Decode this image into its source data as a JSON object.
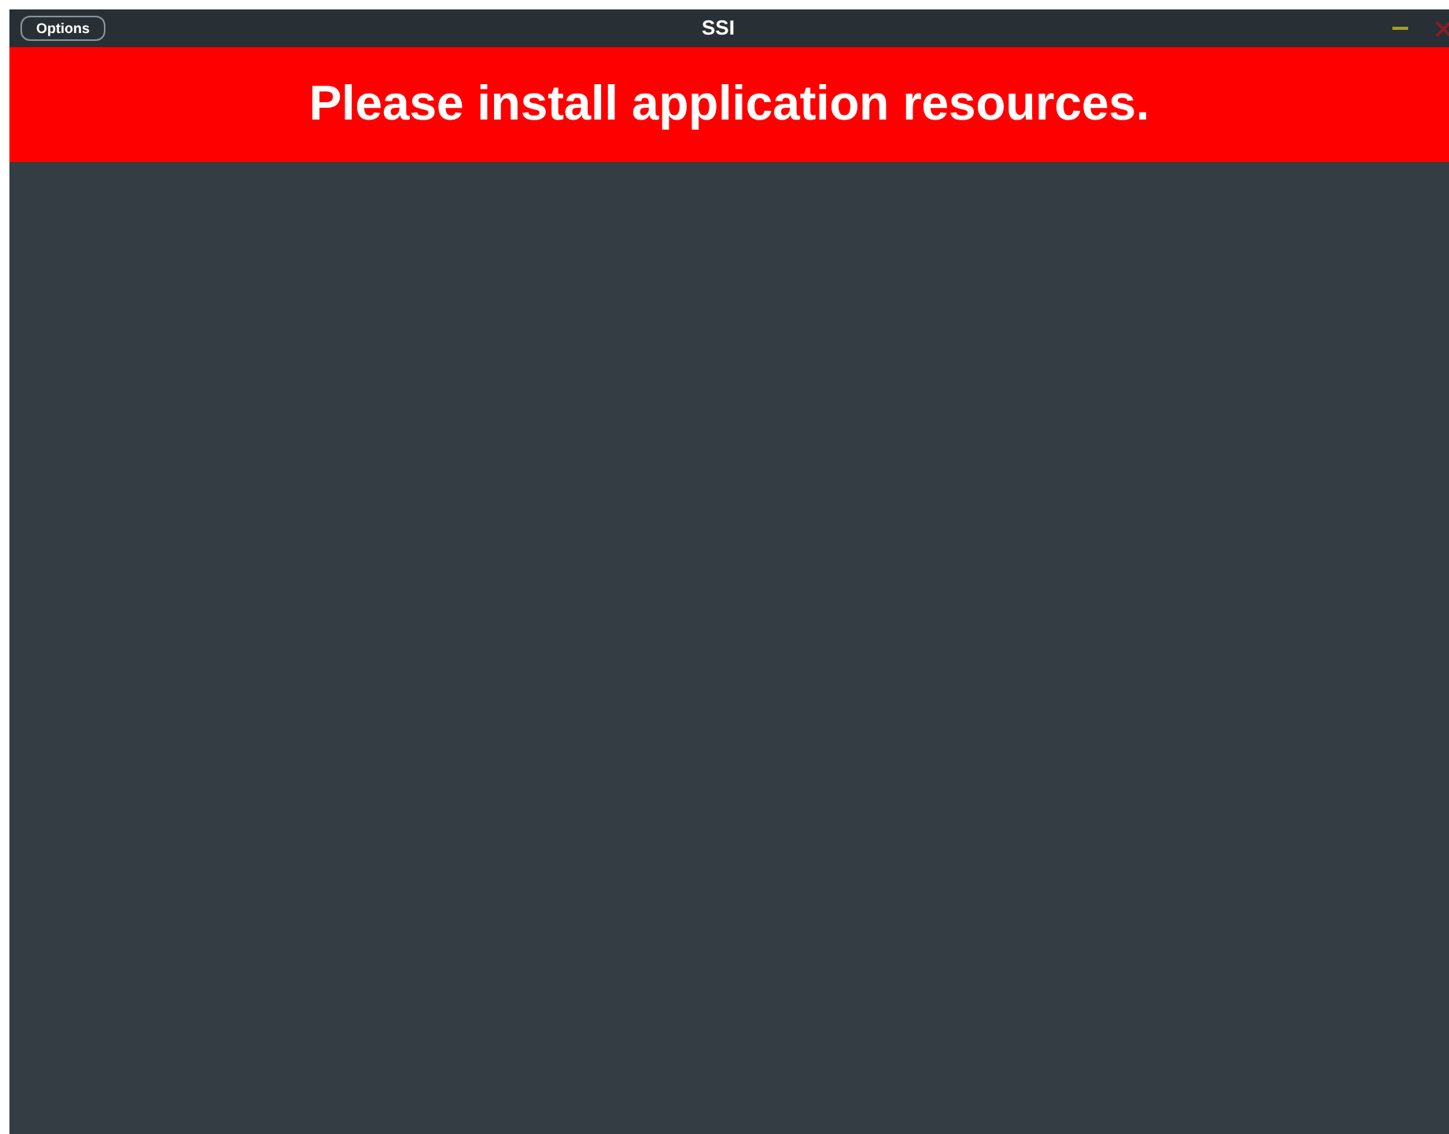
{
  "window": {
    "title": "SSI",
    "options_button": "Options"
  },
  "banner": {
    "message": "Please install application resources."
  }
}
